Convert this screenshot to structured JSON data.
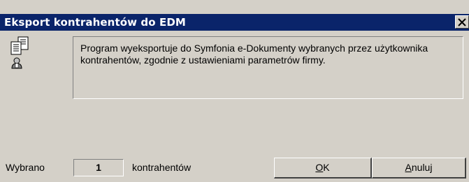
{
  "window": {
    "title": "Eksport kontrahentów do EDM"
  },
  "message": "Program wyeksportuje do Symfonia e-Dokumenty wybranych przez użytkownika kontrahentów, zgodnie z ustawieniami parametrów firmy.",
  "status": {
    "prefix": "Wybrano",
    "count": "1",
    "suffix": "kontrahentów"
  },
  "buttons": {
    "ok": "OK",
    "cancel": "Anuluj"
  },
  "icons": {
    "main": "export-contractors-icon",
    "close": "close-icon"
  },
  "colors": {
    "titlebar": "#0a246a",
    "face": "#d4d0c8"
  }
}
